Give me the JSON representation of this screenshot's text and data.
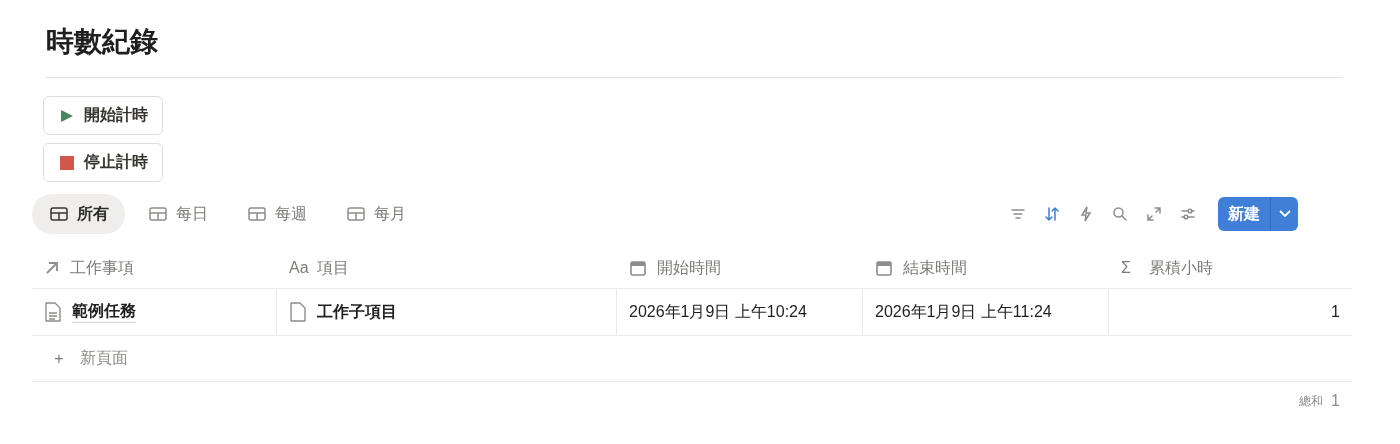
{
  "title": "時數紀錄",
  "buttons": [
    {
      "kind": "play",
      "label": "開始計時"
    },
    {
      "kind": "stop",
      "label": "停止計時"
    }
  ],
  "views": [
    {
      "label": "所有",
      "selected": true
    },
    {
      "label": "每日",
      "selected": false
    },
    {
      "label": "每週",
      "selected": false
    },
    {
      "label": "每月",
      "selected": false
    }
  ],
  "tools": [
    {
      "kind": "filter",
      "active": false
    },
    {
      "kind": "sort",
      "active": true
    },
    {
      "kind": "automation",
      "active": false
    },
    {
      "kind": "search",
      "active": false
    },
    {
      "kind": "expand",
      "active": false
    },
    {
      "kind": "settings",
      "active": false
    }
  ],
  "new_button": {
    "label": "新建"
  },
  "table": {
    "columns": [
      {
        "kind": "relation",
        "label": "工作事項"
      },
      {
        "kind": "title",
        "glyph": "Aa",
        "label": "項目"
      },
      {
        "kind": "date",
        "label": "開始時間"
      },
      {
        "kind": "date",
        "label": "結束時間"
      },
      {
        "kind": "formula",
        "glyph": "Σ",
        "label": "累積小時"
      }
    ],
    "rows": [
      {
        "cells": [
          {
            "kind": "page",
            "text": "範例任務"
          },
          {
            "kind": "blank_page",
            "text": "工作子項目"
          },
          {
            "kind": "text",
            "text": "2026年1月9日 上午10:24"
          },
          {
            "kind": "text",
            "text": "2026年1月9日 上午11:24"
          },
          {
            "kind": "number",
            "text": "1"
          }
        ]
      }
    ],
    "new_row": {
      "glyph": "+",
      "label": "新頁面"
    },
    "footer": {
      "label": "總和",
      "value": "1"
    }
  }
}
